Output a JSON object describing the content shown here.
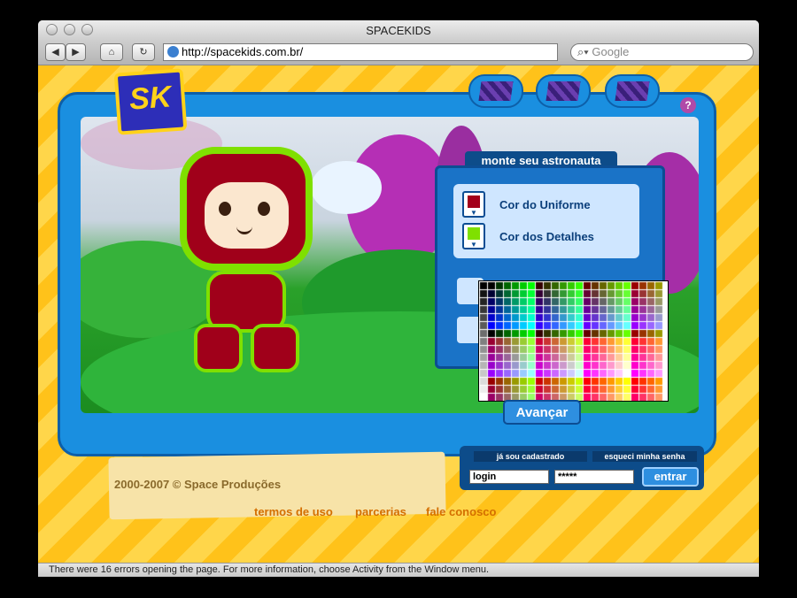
{
  "window": {
    "title": "SPACEKIDS"
  },
  "toolbar": {
    "url": "http://spacekids.com.br/",
    "search_placeholder": "Google"
  },
  "panel": {
    "title": "monte seu astronauta",
    "uniform_label": "Cor do Uniforme",
    "details_label": "Cor dos Detalhes",
    "uniform_color": "#a3001a",
    "details_color": "#7fe000",
    "advance_button": "Avançar"
  },
  "footer": {
    "copyright": "2000-2007 © Space Produções",
    "links": [
      "termos de uso",
      "parcerias",
      "fale conosco"
    ]
  },
  "login": {
    "tab_registered": "já sou cadastrado",
    "tab_forgot": "esqueci minha senha",
    "login_value": "login",
    "password_value": "*****",
    "submit": "entrar"
  },
  "logo_text": "SK",
  "help_icon": "?",
  "status": "There were 16 errors opening the page. For more information, choose Activity from the Window menu."
}
